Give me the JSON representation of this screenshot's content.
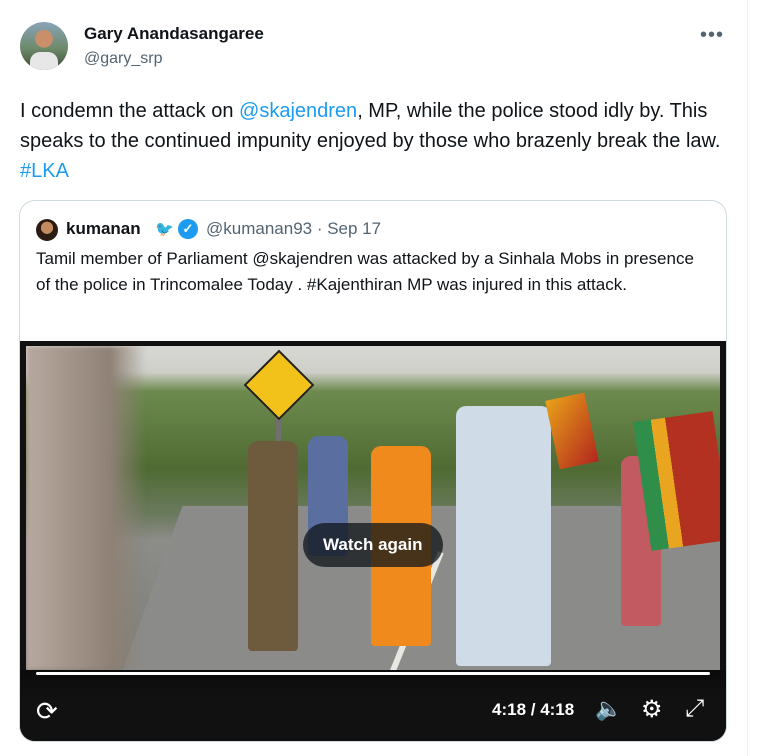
{
  "tweet": {
    "author_name": "Gary Anandasangaree",
    "author_handle": "@gary_srp",
    "more_icon": "•••",
    "text_parts": {
      "t1": "I condemn the attack on ",
      "mention": "@skajendren",
      "t2": ", MP, while the police stood idly by. This speaks to the continued impunity enjoyed by those who brazenly break the law.  ",
      "hashtag": "#LKA"
    }
  },
  "quoted": {
    "author_name": "kumanan",
    "bird_icon": "🐦",
    "verified_icon": "✓",
    "handle_date": "@kumanan93 · Sep 17",
    "text": "Tamil member of Parliament @skajendren was attacked by a Sinhala Mobs in presence of the police in Trincomalee Today . #Kajenthiran MP was injured in this attack."
  },
  "video": {
    "watch_again_label": "Watch again",
    "time": "4:18 / 4:18",
    "progress_fraction": 1.0,
    "icons": {
      "replay": "⟳",
      "volume": "🔈",
      "settings": "⚙",
      "fullscreen": "⤢"
    }
  },
  "colors": {
    "link": "#1d9bf0",
    "secondary_text": "#536471",
    "border": "#cfd9de"
  }
}
